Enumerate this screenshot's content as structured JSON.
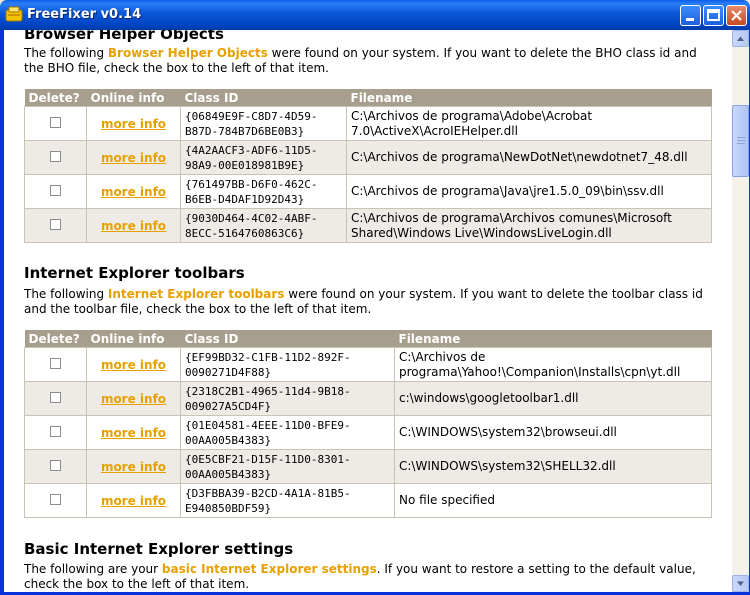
{
  "window": {
    "title": "FreeFixer v0.14"
  },
  "bho": {
    "title": "Browser Helper Objects",
    "desc_pre": "The following ",
    "desc_hl": "Browser Helper Objects",
    "desc_post": " were found on your system. If you want to delete the BHO class id and the BHO file, check the box to the left of that item.",
    "headers": [
      "Delete?",
      "Online info",
      "Class ID",
      "Filename"
    ],
    "rows": [
      {
        "info": "more info",
        "class_id": "{06849E9F-C8D7-4D59-B87D-784B7D6BE0B3}",
        "filename": "C:\\Archivos de programa\\Adobe\\Acrobat 7.0\\ActiveX\\AcroIEHelper.dll"
      },
      {
        "info": "more info",
        "class_id": "{4A2AACF3-ADF6-11D5-98A9-00E018981B9E}",
        "filename": "C:\\Archivos de programa\\NewDotNet\\newdotnet7_48.dll"
      },
      {
        "info": "more info",
        "class_id": "{761497BB-D6F0-462C-B6EB-D4DAF1D92D43}",
        "filename": "C:\\Archivos de programa\\Java\\jre1.5.0_09\\bin\\ssv.dll"
      },
      {
        "info": "more info",
        "class_id": "{9030D464-4C02-4ABF-8ECC-5164760863C6}",
        "filename": "C:\\Archivos de programa\\Archivos comunes\\Microsoft Shared\\Windows Live\\WindowsLiveLogin.dll"
      }
    ]
  },
  "toolbars": {
    "title": "Internet Explorer toolbars",
    "desc_pre": "The following ",
    "desc_hl": "Internet Explorer toolbars",
    "desc_post": " were found on your system. If you want to delete the toolbar class id and the toolbar file, check the box to the left of that item.",
    "headers": [
      "Delete?",
      "Online info",
      "Class ID",
      "Filename"
    ],
    "rows": [
      {
        "info": "more info",
        "class_id": "{EF99BD32-C1FB-11D2-892F-0090271D4F88}",
        "filename": "C:\\Archivos de programa\\Yahoo!\\Companion\\Installs\\cpn\\yt.dll"
      },
      {
        "info": "more info",
        "class_id": "{2318C2B1-4965-11d4-9B18-009027A5CD4F}",
        "filename": "c:\\windows\\googletoolbar1.dll"
      },
      {
        "info": "more info",
        "class_id": "{01E04581-4EEE-11D0-BFE9-00AA005B4383}",
        "filename": "C:\\WINDOWS\\system32\\browseui.dll"
      },
      {
        "info": "more info",
        "class_id": "{0E5CBF21-D15F-11D0-8301-00AA005B4383}",
        "filename": "C:\\WINDOWS\\system32\\SHELL32.dll"
      },
      {
        "info": "more info",
        "class_id": "{D3FBBA39-B2CD-4A1A-81B5-E940850BDF59}",
        "filename": "No file specified"
      }
    ]
  },
  "settings": {
    "title": "Basic Internet Explorer settings",
    "desc_pre": "The following are your ",
    "desc_hl": "basic Internet Explorer settings",
    "desc_post": ". If you want to restore a setting to the default value, check the box to the left of that item."
  },
  "colors": {
    "accent": "#e8a000",
    "header_bg": "#a89e8e",
    "titlebar": "#0a56d8"
  }
}
